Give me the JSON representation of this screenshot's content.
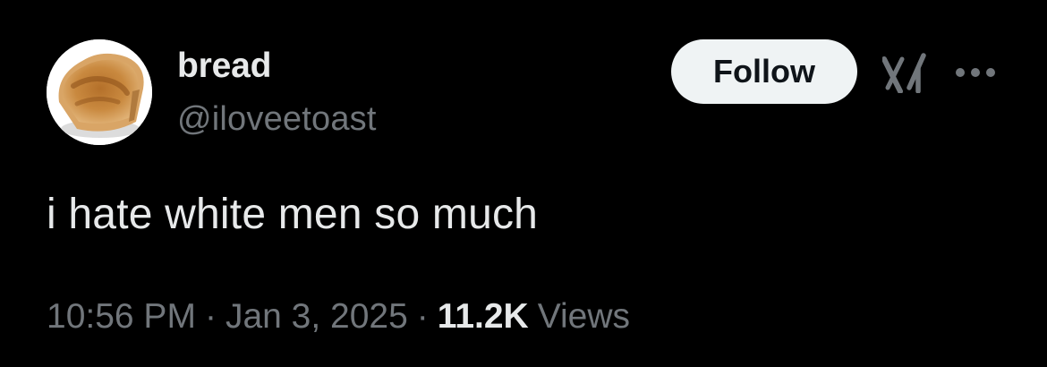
{
  "author": {
    "display_name": "bread",
    "handle": "@iloveetoast",
    "avatar_icon": "toast-avatar"
  },
  "actions": {
    "follow_label": "Follow",
    "grok_icon": "grok-icon",
    "more_icon": "more-options-icon"
  },
  "tweet": {
    "text": "i hate white men so much"
  },
  "meta": {
    "time": "10:56 PM",
    "separator": "·",
    "date": "Jan 3, 2025",
    "views_count": "11.2K",
    "views_label": "Views"
  },
  "colors": {
    "background": "#000000",
    "primary_text": "#e7e9ea",
    "secondary_text": "#71767b",
    "follow_bg": "#eff3f4",
    "follow_text": "#0f1419"
  }
}
